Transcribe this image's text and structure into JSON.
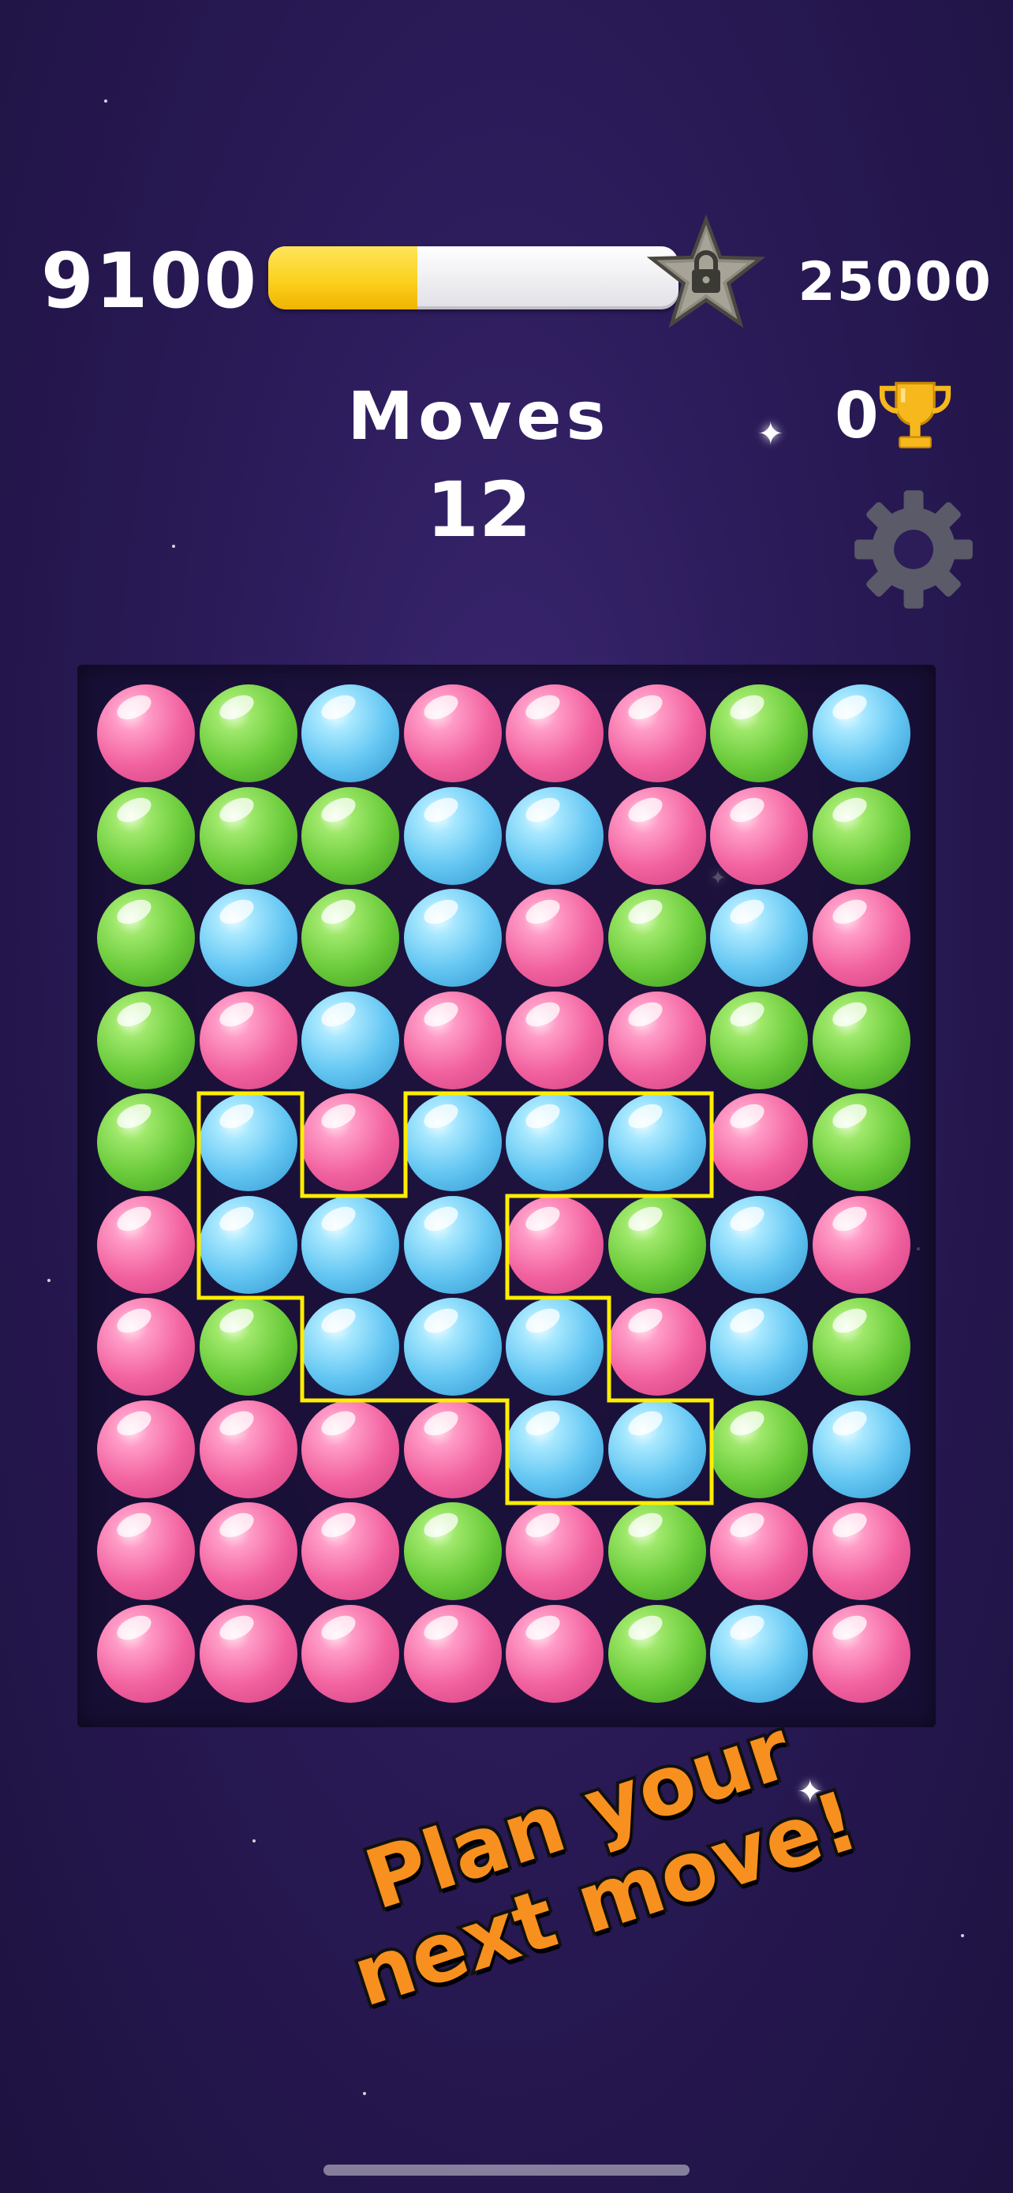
{
  "hud": {
    "score": "9100",
    "target_score": "25000",
    "progress_fraction": 0.364,
    "moves_label": "Moves",
    "moves_value": "12",
    "trophy_count": "0"
  },
  "board": {
    "rows": 10,
    "cols": 8,
    "grid": [
      [
        "pink",
        "green",
        "blue",
        "pink",
        "pink",
        "pink",
        "green",
        "blue"
      ],
      [
        "green",
        "green",
        "green",
        "blue",
        "blue",
        "pink",
        "pink",
        "green"
      ],
      [
        "green",
        "blue",
        "green",
        "blue",
        "pink",
        "green",
        "blue",
        "pink"
      ],
      [
        "green",
        "pink",
        "blue",
        "pink",
        "pink",
        "pink",
        "green",
        "green"
      ],
      [
        "green",
        "blue",
        "pink",
        "blue",
        "blue",
        "blue",
        "pink",
        "green"
      ],
      [
        "pink",
        "blue",
        "blue",
        "blue",
        "pink",
        "green",
        "blue",
        "pink"
      ],
      [
        "pink",
        "green",
        "blue",
        "blue",
        "blue",
        "pink",
        "blue",
        "green"
      ],
      [
        "pink",
        "pink",
        "pink",
        "pink",
        "blue",
        "blue",
        "green",
        "blue"
      ],
      [
        "pink",
        "pink",
        "pink",
        "green",
        "pink",
        "green",
        "pink",
        "pink"
      ],
      [
        "pink",
        "pink",
        "pink",
        "pink",
        "pink",
        "green",
        "blue",
        "pink"
      ]
    ],
    "highlighted_group_color": "blue"
  },
  "slogan": {
    "line1": "Plan your",
    "line2": "next move!"
  },
  "icons": {
    "lock": "lock-star-icon",
    "trophy": "trophy-icon",
    "settings": "gear-icon"
  },
  "colors": {
    "highlight_outline": "#ffee00",
    "slogan": "#f7901e",
    "progress_fill": "#fcd11f"
  }
}
